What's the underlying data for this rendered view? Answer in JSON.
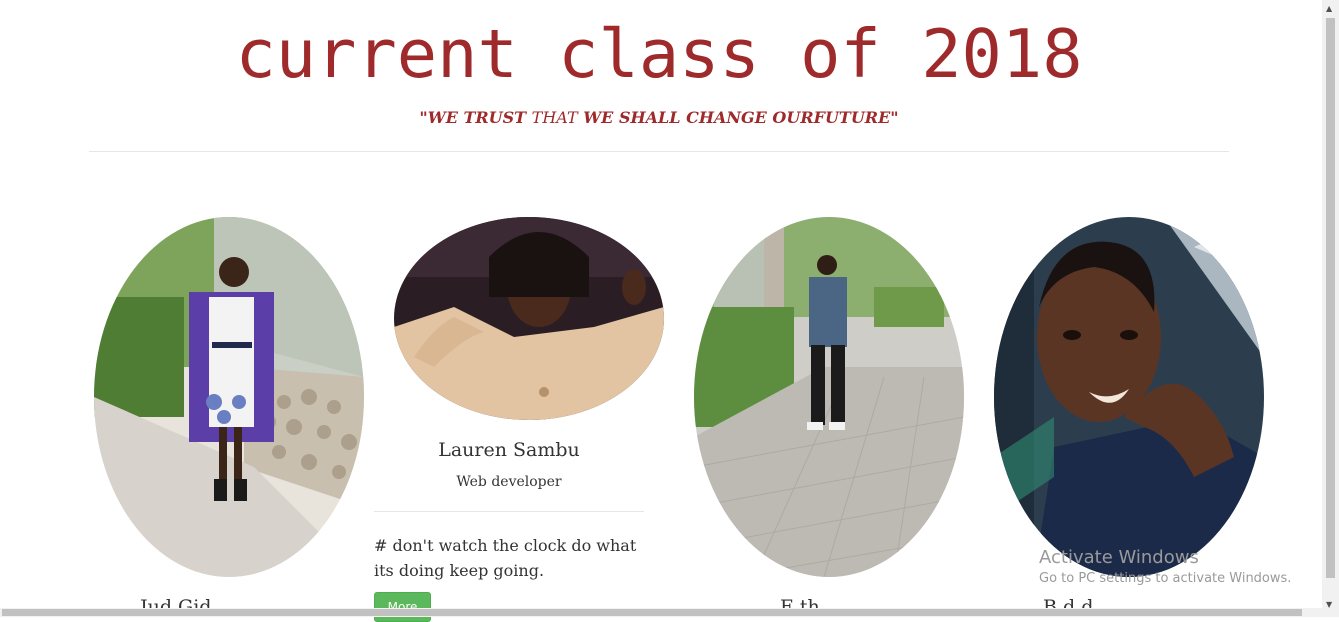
{
  "header": {
    "title": "current class of 2018",
    "tagline_open": "\"WE TRUST ",
    "tagline_that": "THAT",
    "tagline_close": " WE SHALL CHANGE OURFUTURE\""
  },
  "members": [
    {
      "name_visible": "Jud  Gid"
    },
    {
      "name": "Lauren Sambu",
      "role": "Web developer",
      "quote": "# don't watch the clock do what its doing keep going.",
      "more_label": "More"
    },
    {
      "name_visible": "E th"
    },
    {
      "name_visible": "B  d  d"
    }
  ],
  "watermark": {
    "line1": "Activate Windows",
    "line2": "Go to PC settings to activate Windows."
  },
  "colors": {
    "accent": "#9e2a2b",
    "button": "#5cb85c"
  }
}
